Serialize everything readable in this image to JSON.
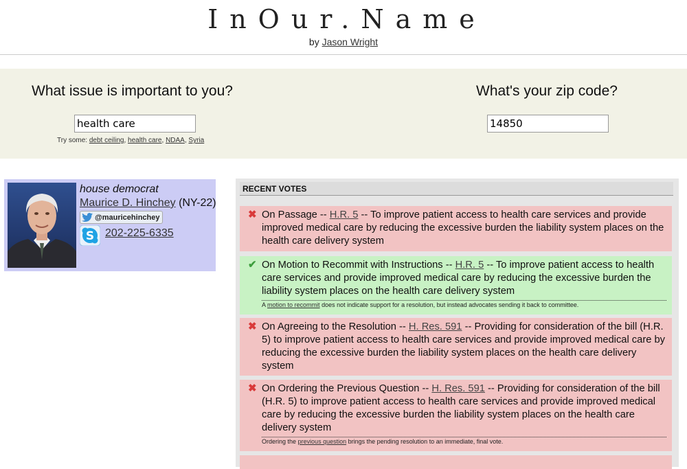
{
  "header": {
    "site_title": "InOur.Name",
    "by_prefix": "by",
    "author": "Jason Wright"
  },
  "question": {
    "issue_label": "What issue is important to you?",
    "issue_value": "health care",
    "zip_label": "What's your zip code?",
    "zip_value": "14850",
    "suggestions_prefix": "Try some:",
    "suggestions": [
      "debt ceiling",
      "health care",
      "NDAA",
      "Syria"
    ]
  },
  "rep": {
    "role": "house democrat",
    "name": "Maurice D. Hinchey",
    "district": "(NY-22)",
    "twitter": "@mauricehinchey",
    "phone": "202-225-6335",
    "twitter_icon": "twitter-bird-icon",
    "skype_icon": "skype-icon"
  },
  "votes": {
    "header": "RECENT VOTES",
    "colors": {
      "nay": "#f2c3c3",
      "yea": "#c8f2c4",
      "nay_mark": "#d93a3a",
      "yea_mark": "#3d9e3d"
    },
    "items": [
      {
        "result": "nay",
        "mark": "✖",
        "motion": "On Passage --",
        "bill": "H.R. 5",
        "description": "-- To improve patient access to health care services and provide improved medical care by reducing the excessive burden the liability system places on the health care delivery system"
      },
      {
        "result": "yea",
        "mark": "✔",
        "motion": "On Motion to Recommit with Instructions --",
        "bill": "H.R. 5",
        "description": "-- To improve patient access to health care services and provide improved medical care by reducing the excessive burden the liability system places on the health care delivery system",
        "note_prefix": "A",
        "note_link": "motion to recommit",
        "note_suffix": "does not indicate support for a resolution, but instead advocates sending it back to committee."
      },
      {
        "result": "nay",
        "mark": "✖",
        "motion": "On Agreeing to the Resolution --",
        "bill": "H. Res. 591",
        "description": "-- Providing for consideration of the bill (H.R. 5) to improve patient access to health care services and provide improved medical care by reducing the excessive burden the liability system places on the health care delivery system"
      },
      {
        "result": "nay",
        "mark": "✖",
        "motion": "On Ordering the Previous Question --",
        "bill": "H. Res. 591",
        "description": "-- Providing for consideration of the bill (H.R. 5) to improve patient access to health care services and provide improved medical care by reducing the excessive burden the liability system places on the health care delivery system",
        "note_prefix": "Ordering the",
        "note_link": "previous question",
        "note_suffix": "brings the pending resolution to an immediate, final vote."
      }
    ]
  }
}
